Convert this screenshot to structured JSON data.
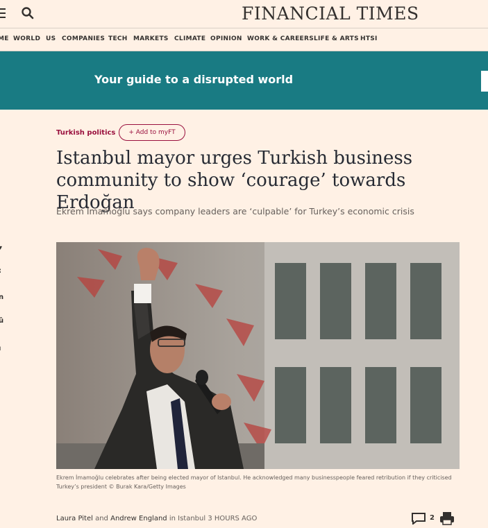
{
  "header": {
    "masthead": "FINANCIAL TIMES",
    "menu_icon": "hamburger-icon",
    "search_icon": "search-icon"
  },
  "nav": {
    "items": [
      "HOME",
      "WORLD",
      "US",
      "COMPANIES",
      "TECH",
      "MARKETS",
      "CLIMATE",
      "OPINION",
      "WORK & CAREERS",
      "LIFE & ARTS",
      "HTSI"
    ],
    "visible_first": "ME"
  },
  "banner": {
    "text": "Your guide to a disrupted world",
    "color": "#197b83"
  },
  "article": {
    "topic": "Turkish politics",
    "myft_label": "+ Add to myFT",
    "headline": "Istanbul mayor urges Turkish business community to show ‘courage’ towards Erdoğan",
    "standfirst": "Ekrem İmamoğlu says company leaders are ‘culpable’ for Turkey’s economic crisis",
    "caption": "Ekrem İmamoğlu celebrates after being elected mayor of Istanbul. He acknowledged many businesspeople feared retribution if they criticised Turkey’s president © Burak Kara/Getty Images",
    "byline": {
      "author1": "Laura Pitel",
      "and": "and",
      "author2": "Andrew England",
      "location": "in Istanbul",
      "time": "3 HOURS AGO"
    },
    "comment_count": "2"
  },
  "share_rail": {
    "labels": [
      "▾",
      ":",
      "n",
      "û",
      "ı"
    ]
  },
  "colors": {
    "background": "#fff1e5",
    "claret": "#990f3d",
    "teal": "#197b83"
  }
}
